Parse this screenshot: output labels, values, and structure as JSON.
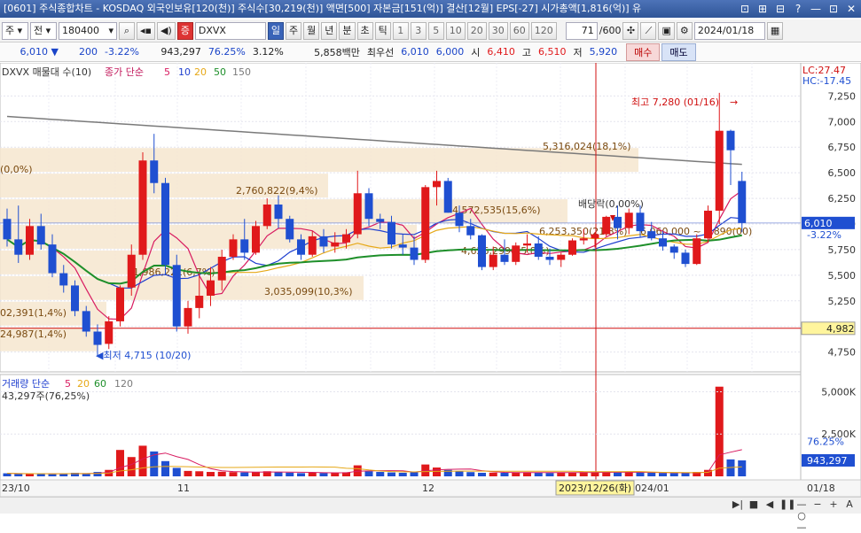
{
  "window": {
    "title": "[0601] 주식종합차트 - KOSDAQ 외국인보유[120(천)] 주식수[30,219(천)] 액면[500] 자본금[151(억)] 결산[12월] EPS[-27] 시가총액[1,816(억)] 유",
    "buttons": [
      "⊡",
      "⊞",
      "⊟",
      "?",
      "—",
      "⊡",
      "✕"
    ]
  },
  "toolbar": {
    "period": "주",
    "range": "전",
    "code": "180400",
    "market_tag": "증",
    "name": "DXVX",
    "intervals": [
      "일",
      "주",
      "월",
      "년",
      "분",
      "초",
      "틱"
    ],
    "selected_interval": "일",
    "minute_options": [
      "1",
      "3",
      "5",
      "10",
      "20",
      "30",
      "60",
      "120"
    ],
    "count": "71",
    "count_total": "/600",
    "date": "2024/01/18"
  },
  "quote": {
    "price": "6,010",
    "arrow": "▼",
    "change": "200",
    "change_pct": "-3.22%",
    "volume": "943,297",
    "vol_ratio": "76.25%",
    "turnover": "3.12%",
    "amount": "5,858백만",
    "best_ask_label": "최우선",
    "best_ask": "6,010",
    "best_bid": "6,000",
    "open_label": "시",
    "open": "6,410",
    "high_label": "고",
    "high": "6,510",
    "low_label": "저",
    "low": "5,920",
    "buy_label": "매수",
    "sell_label": "매도"
  },
  "price_panel": {
    "legend_prefix": "DXVX 매물대 수(10)",
    "ma_label": "종가 단순",
    "ma_periods": [
      "5",
      "10",
      "20",
      "50",
      "150"
    ],
    "ma_colors": [
      "#d81b60",
      "#1f3fcf",
      "#e6a817",
      "#1e8f2a",
      "#7a7a7a"
    ],
    "lc": "LC:27.47",
    "hc": "HC:-17.45",
    "price_ticks": [
      "7,250",
      "7,000",
      "6,750",
      "6,500",
      "6,250",
      "6,000",
      "5,750",
      "5,500",
      "5,250",
      "5,000",
      "4,750"
    ],
    "current_price_tag": "6,010",
    "current_change_tag": "-3.22%",
    "ref_line_tag": "4,982",
    "high_marker": "최고 7,280 (01/16)",
    "low_marker": "최저 4,715 (10/20)",
    "dividend_marker": "배당락(0,00%)",
    "profile_labels": [
      "5,316,024(18,1%)",
      "2,760,822(9,4%)",
      "1,986,221(6,7%)",
      "3,035,099(10,3%)",
      "4,572,535(15,6%)",
      "6,253,350(21,3%)",
      "4,626,299(15,8%)",
      "6,060,000 ~ 5,890(00)",
      "(0,0%)",
      "02,391(1,4%)",
      "24,987(1,4%)"
    ]
  },
  "volume_panel": {
    "legend": "거래량  단순",
    "ma_periods": [
      "5",
      "20",
      "60",
      "120"
    ],
    "value_text": "43,297주(76,25%)",
    "ticks": [
      "5,000K",
      "2,500K"
    ],
    "pct_label": "76.25%",
    "current_tag": "943,297"
  },
  "x_axis": {
    "labels": [
      "23/10",
      "11",
      "12",
      "024/01"
    ],
    "cursor_label": "2023/12/26(화)",
    "last_label": "01/18"
  },
  "chart_data": {
    "type": "candlestick",
    "colors": {
      "up": "#e0191b",
      "down": "#1f4fd1",
      "ma5": "#d81b60",
      "ma10": "#1f3fcf",
      "ma20": "#e6a817",
      "ma50": "#1e8f2a",
      "ma150": "#7a7a7a"
    },
    "ylim": [
      4600,
      7400
    ],
    "volume_ylim": [
      0,
      5600
    ],
    "candles": [
      [
        6050,
        6150,
        5780,
        5850
      ],
      [
        5850,
        6180,
        5620,
        5700
      ],
      [
        5700,
        6050,
        5650,
        5980
      ],
      [
        5980,
        6100,
        5750,
        5800
      ],
      [
        5800,
        5900,
        5480,
        5520
      ],
      [
        5520,
        5600,
        5330,
        5400
      ],
      [
        5400,
        5450,
        5100,
        5150
      ],
      [
        5150,
        5200,
        4900,
        4950
      ],
      [
        4950,
        5020,
        4715,
        4820
      ],
      [
        4830,
        5100,
        4780,
        5050
      ],
      [
        5050,
        5400,
        5000,
        5380
      ],
      [
        5380,
        5800,
        5300,
        5700
      ],
      [
        5700,
        6700,
        5650,
        6620
      ],
      [
        6620,
        6880,
        6300,
        6400
      ],
      [
        6400,
        6450,
        5500,
        5600
      ],
      [
        5600,
        5700,
        4950,
        5000
      ],
      [
        5000,
        5250,
        4930,
        5180
      ],
      [
        5180,
        5520,
        5080,
        5300
      ],
      [
        5300,
        5580,
        5200,
        5450
      ],
      [
        5450,
        5750,
        5350,
        5680
      ],
      [
        5680,
        5900,
        5650,
        5850
      ],
      [
        5850,
        6050,
        5650,
        5720
      ],
      [
        5720,
        6030,
        5700,
        5980
      ],
      [
        5980,
        6250,
        5950,
        6190
      ],
      [
        6190,
        6280,
        5960,
        6050
      ],
      [
        6050,
        6080,
        5820,
        5850
      ],
      [
        5850,
        5900,
        5650,
        5700
      ],
      [
        5700,
        5930,
        5680,
        5880
      ],
      [
        5880,
        5950,
        5720,
        5780
      ],
      [
        5780,
        5920,
        5720,
        5820
      ],
      [
        5820,
        5950,
        5760,
        5900
      ],
      [
        5900,
        6520,
        5860,
        6300
      ],
      [
        6300,
        6350,
        5980,
        6050
      ],
      [
        6050,
        6100,
        5950,
        6020
      ],
      [
        6020,
        6080,
        5760,
        5800
      ],
      [
        5800,
        5900,
        5700,
        5770
      ],
      [
        5770,
        5880,
        5600,
        5650
      ],
      [
        5650,
        6380,
        5620,
        6360
      ],
      [
        6360,
        6520,
        6180,
        6420
      ],
      [
        6420,
        6450,
        6110,
        6110
      ],
      [
        6110,
        6180,
        5920,
        5980
      ],
      [
        5980,
        6050,
        5850,
        5890
      ],
      [
        5890,
        5900,
        5550,
        5580
      ],
      [
        5580,
        5780,
        5550,
        5700
      ],
      [
        5700,
        5850,
        5600,
        5630
      ],
      [
        5630,
        5820,
        5600,
        5790
      ],
      [
        5790,
        5900,
        5720,
        5810
      ],
      [
        5810,
        5880,
        5650,
        5680
      ],
      [
        5680,
        5760,
        5600,
        5650
      ],
      [
        5650,
        5720,
        5580,
        5700
      ],
      [
        5700,
        5860,
        5690,
        5840
      ],
      [
        5840,
        5950,
        5800,
        5860
      ],
      [
        5860,
        5920,
        5770,
        5900
      ],
      [
        5900,
        6080,
        5880,
        6070
      ],
      [
        6070,
        6180,
        5850,
        5960
      ],
      [
        5960,
        6150,
        5900,
        6110
      ],
      [
        6110,
        6180,
        5870,
        5930
      ],
      [
        5930,
        6020,
        5840,
        5860
      ],
      [
        5860,
        5930,
        5740,
        5780
      ],
      [
        5780,
        5800,
        5660,
        5720
      ],
      [
        5720,
        5750,
        5580,
        5610
      ],
      [
        5610,
        5900,
        5600,
        5860
      ],
      [
        5860,
        6180,
        5820,
        6130
      ],
      [
        6130,
        7280,
        6000,
        6910
      ],
      [
        6910,
        6920,
        6380,
        6720
      ],
      [
        6420,
        6510,
        5920,
        6010
      ]
    ],
    "volumes": [
      180,
      150,
      140,
      160,
      130,
      170,
      210,
      150,
      260,
      380,
      1560,
      1140,
      1810,
      1470,
      900,
      500,
      320,
      300,
      260,
      270,
      250,
      230,
      240,
      300,
      260,
      220,
      190,
      220,
      200,
      210,
      240,
      650,
      300,
      260,
      230,
      210,
      240,
      700,
      520,
      380,
      300,
      250,
      210,
      220,
      210,
      230,
      240,
      220,
      200,
      210,
      230,
      250,
      240,
      260,
      230,
      240,
      230,
      210,
      200,
      190,
      210,
      260,
      380,
      5300,
      1000,
      943
    ]
  }
}
